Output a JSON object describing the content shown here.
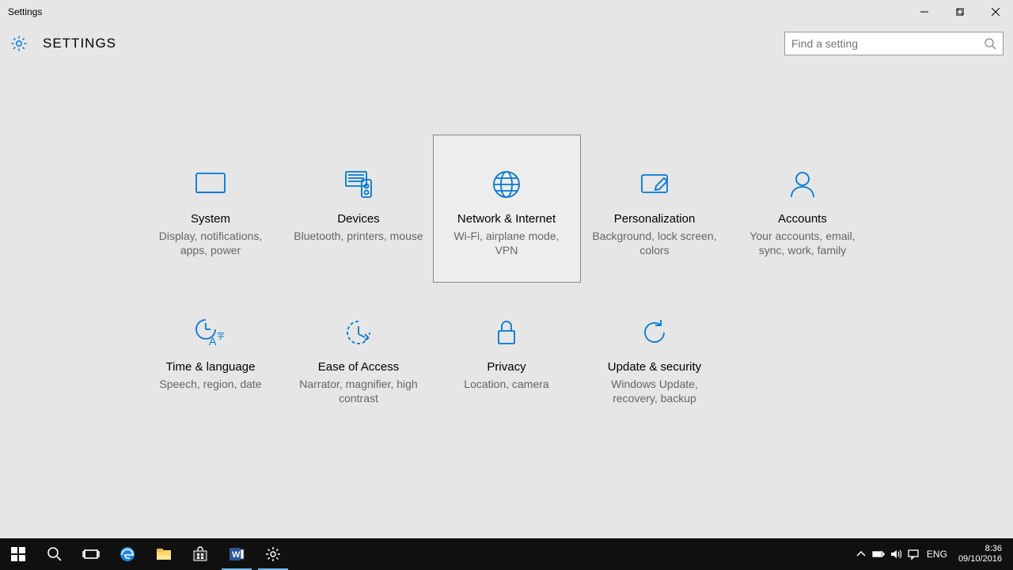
{
  "window": {
    "title": "Settings"
  },
  "header": {
    "page_title": "SETTINGS"
  },
  "search": {
    "placeholder": "Find a setting"
  },
  "tiles": [
    {
      "label": "System",
      "desc": "Display, notifications, apps, power"
    },
    {
      "label": "Devices",
      "desc": "Bluetooth, printers, mouse"
    },
    {
      "label": "Network & Internet",
      "desc": "Wi-Fi, airplane mode, VPN"
    },
    {
      "label": "Personalization",
      "desc": "Background, lock screen, colors"
    },
    {
      "label": "Accounts",
      "desc": "Your accounts, email, sync, work, family"
    },
    {
      "label": "Time & language",
      "desc": "Speech, region, date"
    },
    {
      "label": "Ease of Access",
      "desc": "Narrator, magnifier, high contrast"
    },
    {
      "label": "Privacy",
      "desc": "Location, camera"
    },
    {
      "label": "Update & security",
      "desc": "Windows Update, recovery, backup"
    }
  ],
  "taskbar": {
    "lang": "ENG",
    "time": "8:36",
    "date": "09/10/2016"
  }
}
